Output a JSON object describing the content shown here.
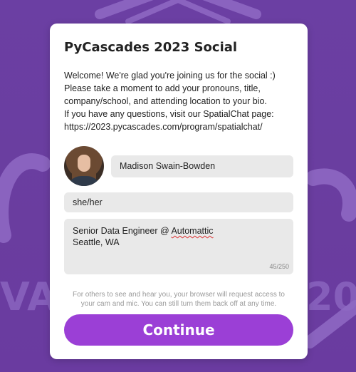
{
  "modal": {
    "title": "PyCascades 2023 Social",
    "welcome_lines": [
      " Welcome! We're glad you're joining us for the social :)",
      "Please take a moment to add your pronouns, title,",
      "company/school, and attending location to your bio.",
      "If you have any questions, visit our SpatialChat page:",
      "https://2023.pycascades.com/program/spatialchat/"
    ],
    "name_value": "Madison Swain-Bowden",
    "pronouns_value": "she/her",
    "bio": {
      "line1_prefix": "Senior Data Engineer @ ",
      "line1_misspelled": "Automattic",
      "line2": "Seattle, WA",
      "char_count": "45/250"
    },
    "notice": "For others to see and hear you, your browser will request access to your cam and mic. You can still turn them back off at any time.",
    "continue_label": "Continue"
  },
  "colors": {
    "background": "#6a3fa0",
    "button": "#9b3fd6",
    "field": "#e9e9e9"
  }
}
